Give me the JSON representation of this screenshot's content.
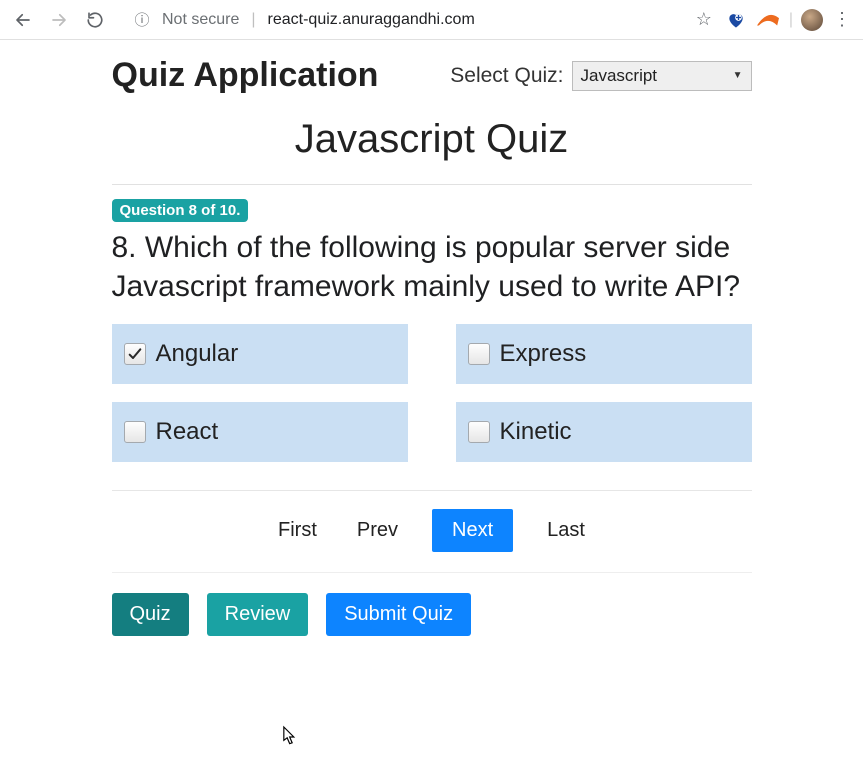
{
  "browser": {
    "not_secure": "Not secure",
    "url": "react-quiz.anuraggandhi.com"
  },
  "header": {
    "app_title": "Quiz Application",
    "select_quiz_label": "Select Quiz:",
    "selected_quiz": "Javascript"
  },
  "quiz": {
    "title": "Javascript Quiz",
    "progress_badge": "Question 8 of 10.",
    "question_number": 8,
    "total_questions": 10,
    "question_text": "8. Which of the following is popular server side Javascript framework mainly used to write API?",
    "options": [
      {
        "label": "Angular",
        "checked": true
      },
      {
        "label": "Express",
        "checked": false
      },
      {
        "label": "React",
        "checked": false
      },
      {
        "label": "Kinetic",
        "checked": false
      }
    ]
  },
  "pagination": {
    "first": "First",
    "prev": "Prev",
    "next": "Next",
    "last": "Last",
    "active": "next"
  },
  "actions": {
    "quiz": "Quiz",
    "review": "Review",
    "submit": "Submit Quiz"
  },
  "colors": {
    "accent_primary": "#0d84ff",
    "accent_teal": "#1aa2a3",
    "accent_teal_dark": "#147e80",
    "option_bg": "#cadff3"
  }
}
